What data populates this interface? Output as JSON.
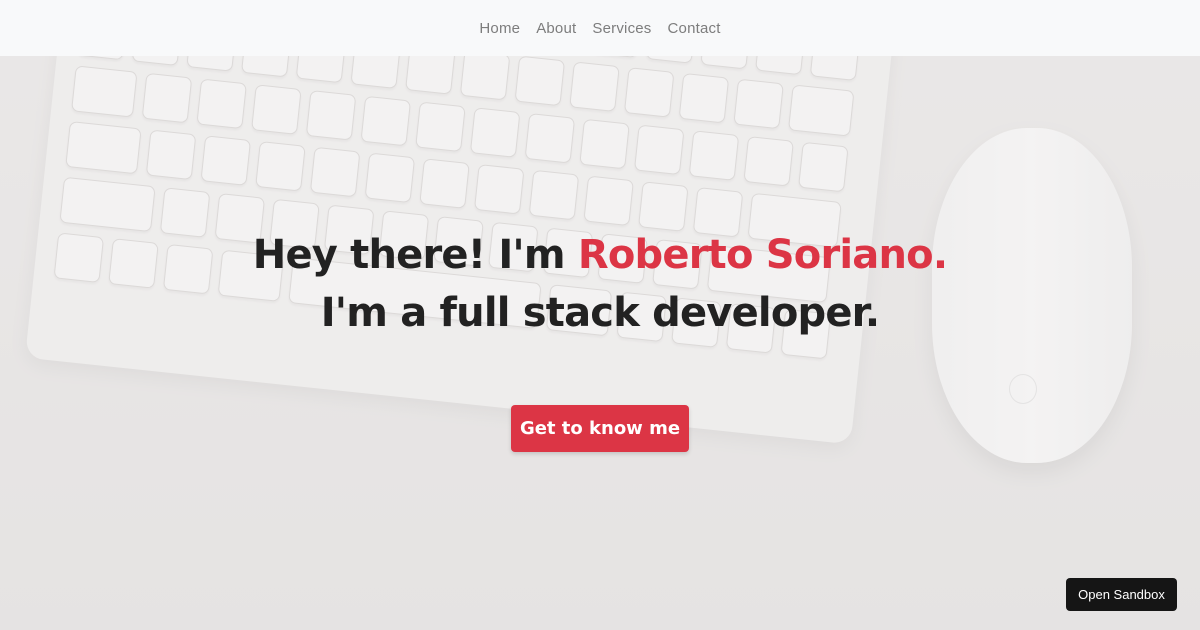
{
  "nav": {
    "items": [
      {
        "label": "Home"
      },
      {
        "label": "About"
      },
      {
        "label": "Services"
      },
      {
        "label": "Contact"
      }
    ]
  },
  "hero": {
    "greeting": "Hey there! I'm ",
    "name": "Roberto Soriano.",
    "tagline": "I'm a full stack developer.",
    "cta_label": "Get to know me"
  },
  "sandbox": {
    "label": "Open Sandbox"
  },
  "colors": {
    "accent": "#dc3545",
    "heading": "#222222",
    "navbar_bg": "#f8f9fa",
    "sandbox_bg": "#151515"
  }
}
